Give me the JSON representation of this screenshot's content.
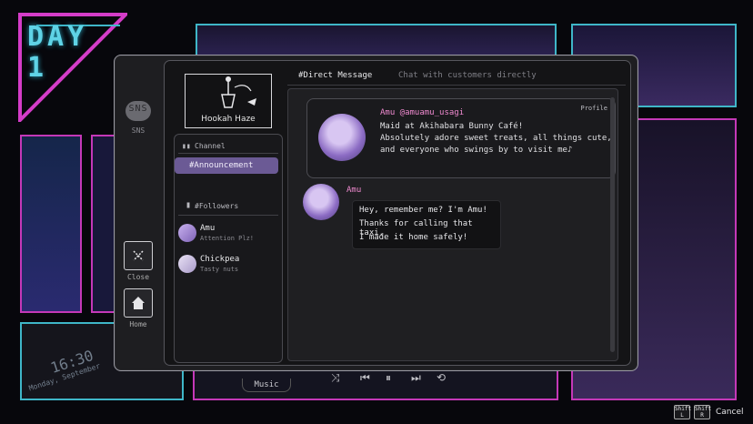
{
  "background": {
    "day_label": "DAY\n1",
    "clock_time": "16:30",
    "clock_date": "Monday, September"
  },
  "rail": {
    "sns_icon_label": "SNS",
    "sns_label": "SNS",
    "close_label": "Close",
    "home_label": "Home"
  },
  "logo": {
    "name": "Hookah Haze"
  },
  "channels": {
    "header": "Channel",
    "items": [
      {
        "label": "#Announcement"
      }
    ]
  },
  "followers": {
    "header": "#Followers",
    "items": [
      {
        "name": "Amu",
        "status": "Attention Plz!"
      },
      {
        "name": "Chickpea",
        "status": "Tasty nuts"
      }
    ]
  },
  "dm": {
    "title": "#Direct Message",
    "subtitle": "Chat with customers directly",
    "profile": {
      "handle": "Amu @amuamu_usagi",
      "bio": "Maid at Akihabara Bunny Café!\nAbsolutely adore sweet treats, all things cute,\nand everyone who swings by to visit me♪",
      "profile_link": "Profile"
    },
    "message": {
      "sender": "Amu",
      "lines": [
        "Hey, remember me? I'm Amu!",
        "Thanks for calling that taxi.",
        "I made it home safely!"
      ]
    }
  },
  "music": {
    "label": "Music"
  },
  "footer": {
    "shift_l": "Shift\nL",
    "shift_r": "Shift\nR",
    "cancel": "Cancel"
  },
  "colors": {
    "accent_pink": "#f08ad0",
    "channel_selected": "#6b5a95",
    "neon_cyan": "#5fd3e6",
    "neon_pink": "#d43cc8"
  }
}
